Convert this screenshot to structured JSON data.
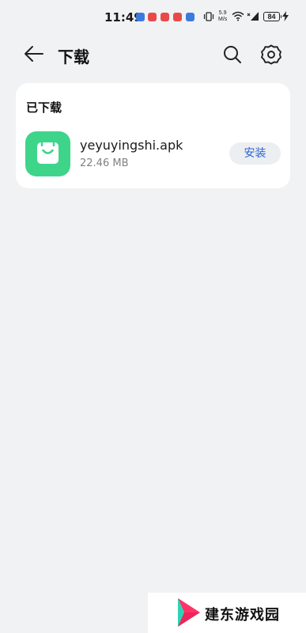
{
  "status_bar": {
    "time": "11:49",
    "net_speed_value": "5.9",
    "net_speed_unit": "M/s",
    "battery": "84",
    "notification_colors": [
      "#3b7be0",
      "#e84a4a",
      "#e84a4a",
      "#e84a4a",
      "#3b7be0"
    ]
  },
  "header": {
    "title": "下载",
    "back_icon": "arrow-left-icon",
    "search_icon": "search-icon",
    "settings_icon": "gear-icon"
  },
  "downloaded": {
    "section_title": "已下载",
    "items": [
      {
        "file_name": "yeyuyingshi.apk",
        "file_size": "22.46 MB",
        "icon": "shopping-bag-icon",
        "icon_color": "#3ed58a",
        "action_label": "安装"
      }
    ]
  },
  "watermark": {
    "text": "建东游戏园"
  },
  "colors": {
    "background": "#f1f2f4",
    "card": "#ffffff",
    "accent": "#2c66d4"
  }
}
